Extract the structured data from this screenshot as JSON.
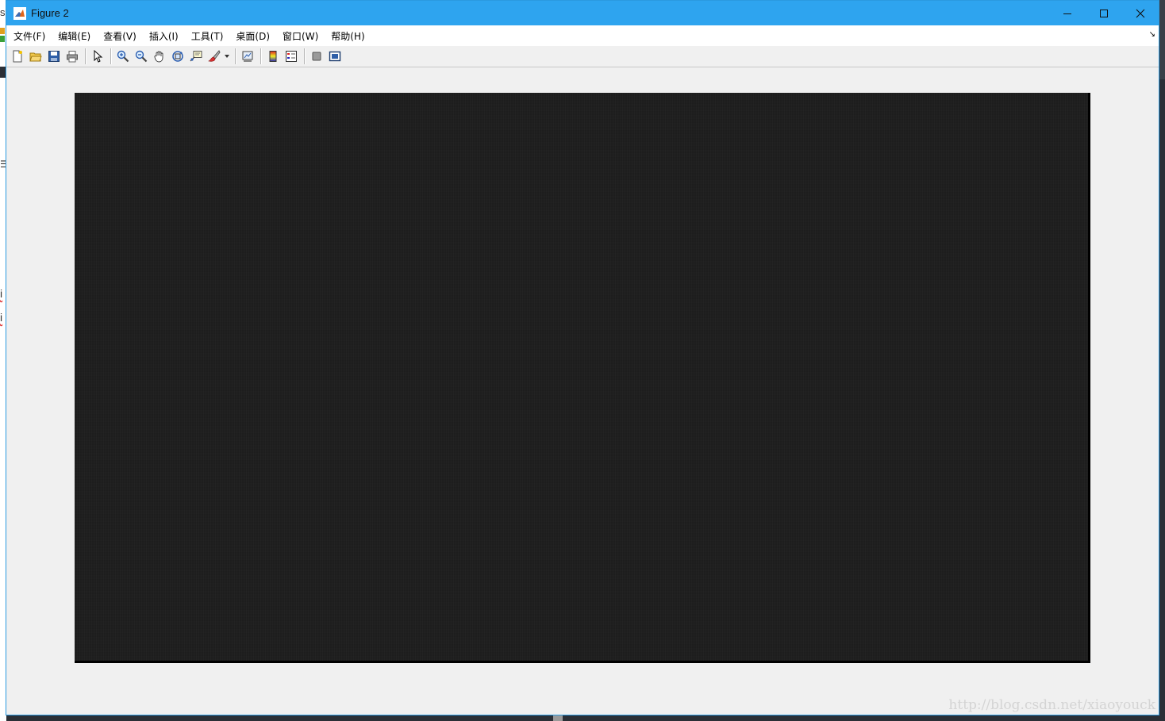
{
  "window": {
    "title": "Figure 2",
    "accent_color": "#2ea4ef",
    "icon": "matlab-icon"
  },
  "window_controls": [
    "minimize-icon",
    "maximize-icon",
    "close-icon"
  ],
  "menu": {
    "items": [
      "文件(F)",
      "编辑(E)",
      "查看(V)",
      "插入(I)",
      "工具(T)",
      "桌面(D)",
      "窗口(W)",
      "帮助(H)"
    ]
  },
  "toolbar": {
    "groups": [
      [
        "new-figure-icon",
        "open-file-icon",
        "save-icon",
        "print-icon"
      ],
      [
        "edit-plot-pointer-icon"
      ],
      [
        "zoom-in-icon",
        "zoom-out-icon",
        "pan-hand-icon",
        "rotate-3d-icon",
        "data-cursor-icon",
        "brush-icon"
      ],
      [
        "link-plot-icon"
      ],
      [
        "colorbar-icon",
        "legend-icon"
      ],
      [
        "hide-plot-tools-icon",
        "show-plot-tools-icon"
      ]
    ]
  },
  "figure": {
    "image_color": "#1f1f1f"
  },
  "watermark": "http://blog.csdn.net/xiaoyouck",
  "background_fragments": [
    "s",
    "i",
    "i"
  ]
}
